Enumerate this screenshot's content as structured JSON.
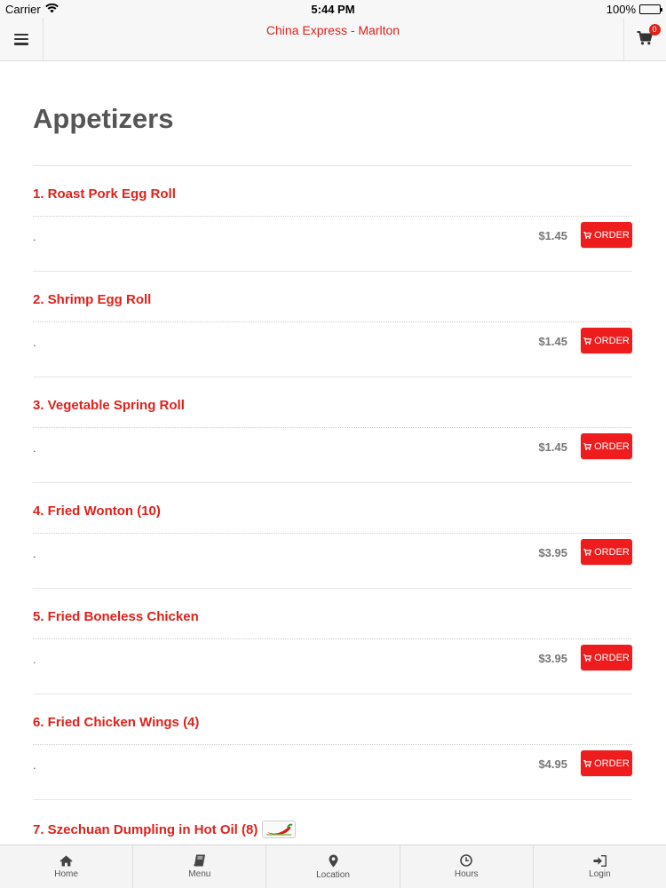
{
  "status_bar": {
    "carrier": "Carrier",
    "time": "5:44 PM",
    "battery": "100%"
  },
  "nav": {
    "title": "China Express - Marlton",
    "cart_count": "0"
  },
  "category": {
    "title": "Appetizers"
  },
  "order_label": "ORDER",
  "items": [
    {
      "name": "1. Roast Pork Egg Roll",
      "description": ".",
      "price": "$1.45"
    },
    {
      "name": "2. Shrimp Egg Roll",
      "description": ".",
      "price": "$1.45"
    },
    {
      "name": "3. Vegetable Spring Roll",
      "description": ".",
      "price": "$1.45"
    },
    {
      "name": "4. Fried Wonton (10)",
      "description": ".",
      "price": "$3.95"
    },
    {
      "name": "5. Fried Boneless Chicken",
      "description": ".",
      "price": "$3.95"
    },
    {
      "name": "6. Fried Chicken Wings (4)",
      "description": ".",
      "price": "$4.95"
    },
    {
      "name": "7. Szechuan Dumpling in Hot Oil (8)",
      "description": "",
      "price": "",
      "spicy": true
    }
  ],
  "tabs": [
    {
      "label": "Home",
      "icon": "home-icon"
    },
    {
      "label": "Menu",
      "icon": "book-icon"
    },
    {
      "label": "Location",
      "icon": "map-marker-icon"
    },
    {
      "label": "Hours",
      "icon": "clock-icon"
    },
    {
      "label": "Login",
      "icon": "sign-in-icon"
    }
  ],
  "colors": {
    "accent": "#e0211b",
    "order_button": "#ee1c1c",
    "heading": "#555555",
    "price": "#777777"
  }
}
